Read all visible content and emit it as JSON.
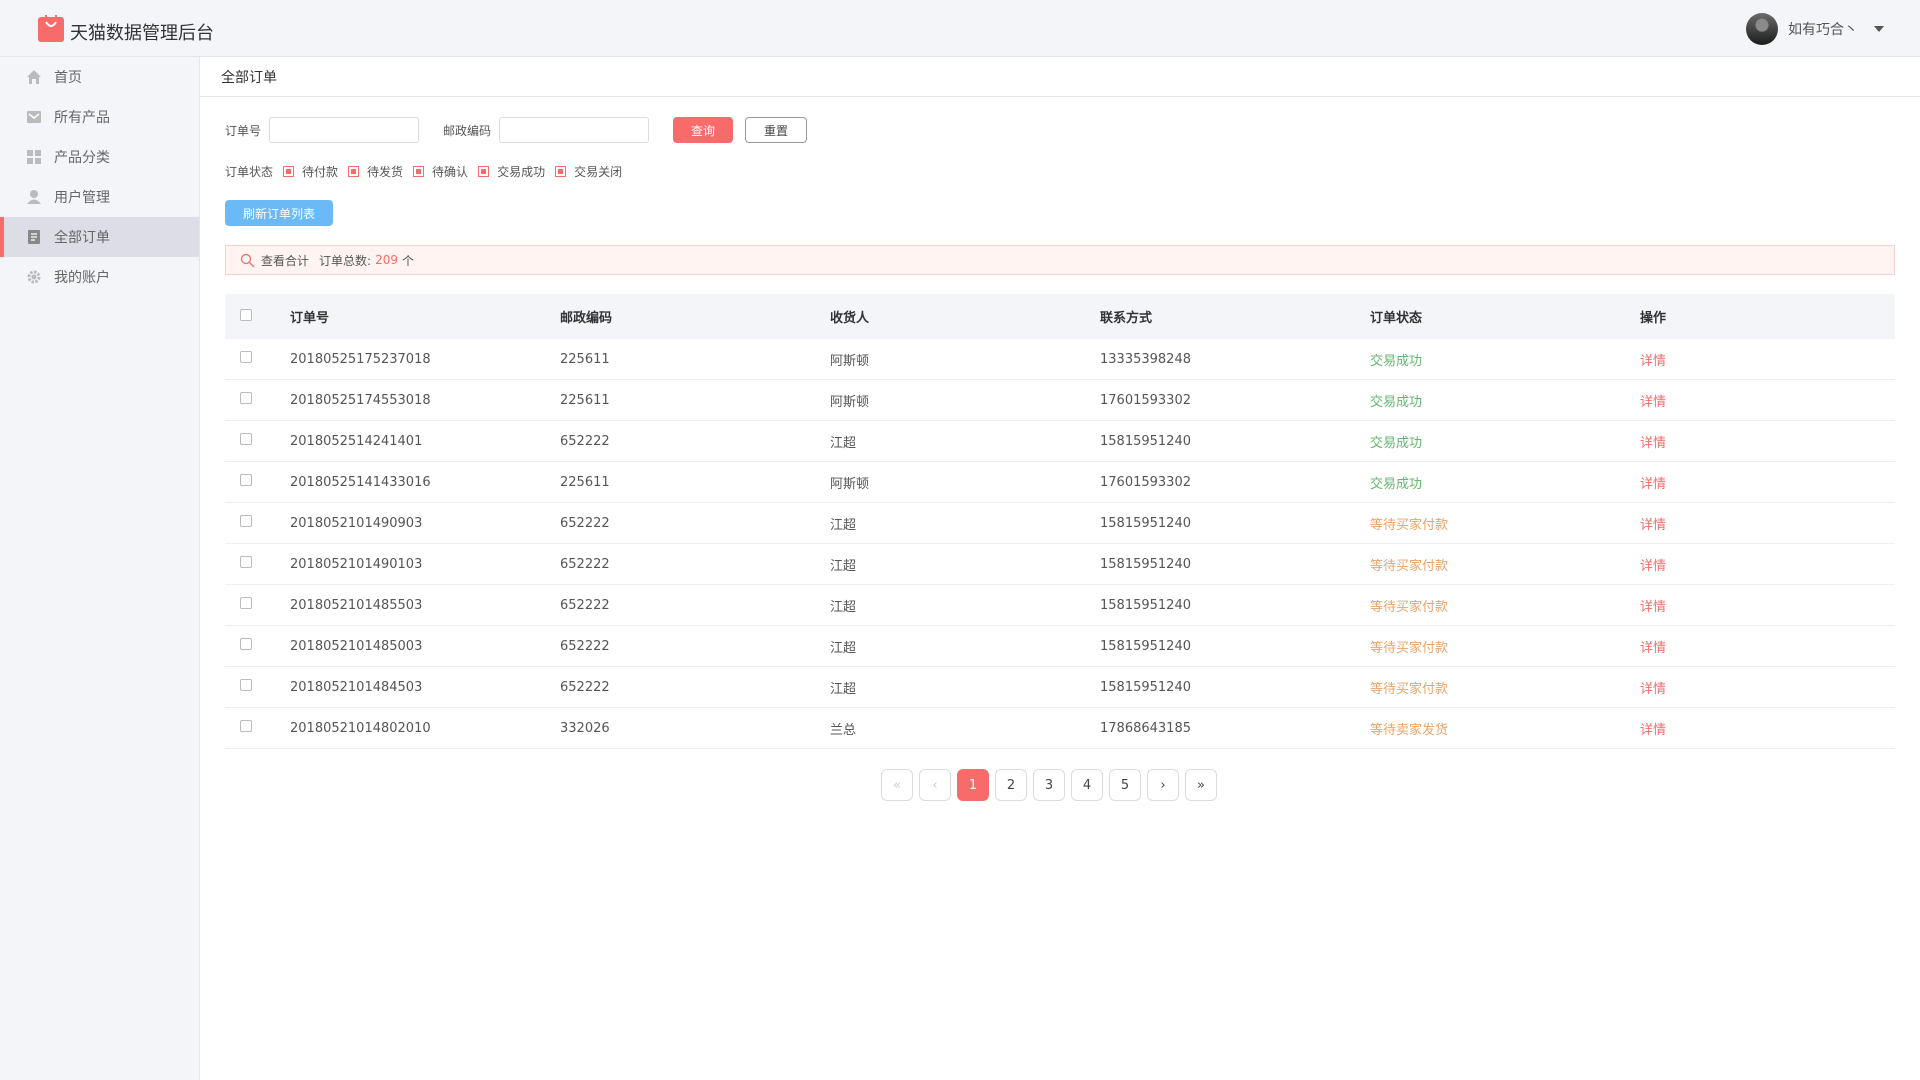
{
  "header": {
    "app_title": "天猫数据管理后台",
    "username": "如有巧合丶"
  },
  "sidebar": {
    "items": [
      {
        "label": "首页",
        "icon": "home-icon"
      },
      {
        "label": "所有产品",
        "icon": "product-icon"
      },
      {
        "label": "产品分类",
        "icon": "category-icon"
      },
      {
        "label": "用户管理",
        "icon": "user-icon"
      },
      {
        "label": "全部订单",
        "icon": "order-icon",
        "active": true
      },
      {
        "label": "我的账户",
        "icon": "gear-icon"
      }
    ]
  },
  "breadcrumb": "全部订单",
  "filters": {
    "order_no_label": "订单号",
    "order_no_value": "",
    "postcode_label": "邮政编码",
    "postcode_value": "",
    "query_label": "查询",
    "reset_label": "重置",
    "status_label": "订单状态",
    "status_options": [
      "待付款",
      "待发货",
      "待确认",
      "交易成功",
      "交易关闭"
    ],
    "refresh_label": "刷新订单列表"
  },
  "summary": {
    "view_label": "查看合计",
    "total_label": "订单总数:",
    "total_count": "209",
    "unit": "个"
  },
  "table": {
    "headers": [
      "订单号",
      "邮政编码",
      "收货人",
      "联系方式",
      "订单状态",
      "操作"
    ],
    "rows": [
      {
        "order_no": "20180525175237018",
        "postcode": "225611",
        "receiver": "阿斯顿",
        "phone": "13335398248",
        "status": "交易成功",
        "action": "详情"
      },
      {
        "order_no": "20180525174553018",
        "postcode": "225611",
        "receiver": "阿斯顿",
        "phone": "17601593302",
        "status": "交易成功",
        "action": "详情"
      },
      {
        "order_no": "2018052514241401",
        "postcode": "652222",
        "receiver": "江超",
        "phone": "15815951240",
        "status": "交易成功",
        "action": "详情"
      },
      {
        "order_no": "20180525141433016",
        "postcode": "225611",
        "receiver": "阿斯顿",
        "phone": "17601593302",
        "status": "交易成功",
        "action": "详情"
      },
      {
        "order_no": "2018052101490903",
        "postcode": "652222",
        "receiver": "江超",
        "phone": "15815951240",
        "status": "等待买家付款",
        "action": "详情"
      },
      {
        "order_no": "2018052101490103",
        "postcode": "652222",
        "receiver": "江超",
        "phone": "15815951240",
        "status": "等待买家付款",
        "action": "详情"
      },
      {
        "order_no": "2018052101485503",
        "postcode": "652222",
        "receiver": "江超",
        "phone": "15815951240",
        "status": "等待买家付款",
        "action": "详情"
      },
      {
        "order_no": "2018052101485003",
        "postcode": "652222",
        "receiver": "江超",
        "phone": "15815951240",
        "status": "等待买家付款",
        "action": "详情"
      },
      {
        "order_no": "2018052101484503",
        "postcode": "652222",
        "receiver": "江超",
        "phone": "15815951240",
        "status": "等待买家付款",
        "action": "详情"
      },
      {
        "order_no": "20180521014802010",
        "postcode": "332026",
        "receiver": "兰总",
        "phone": "17868643185",
        "status": "等待卖家发货",
        "action": "详情"
      }
    ]
  },
  "pagination": {
    "first": "«",
    "prev": "‹",
    "pages": [
      "1",
      "2",
      "3",
      "4",
      "5"
    ],
    "current": "1",
    "next": "›",
    "last": "»"
  },
  "colors": {
    "accent": "#f76b6b",
    "success": "#65b570",
    "waiting": "#e8a46c",
    "refresh": "#6cbaf5"
  }
}
